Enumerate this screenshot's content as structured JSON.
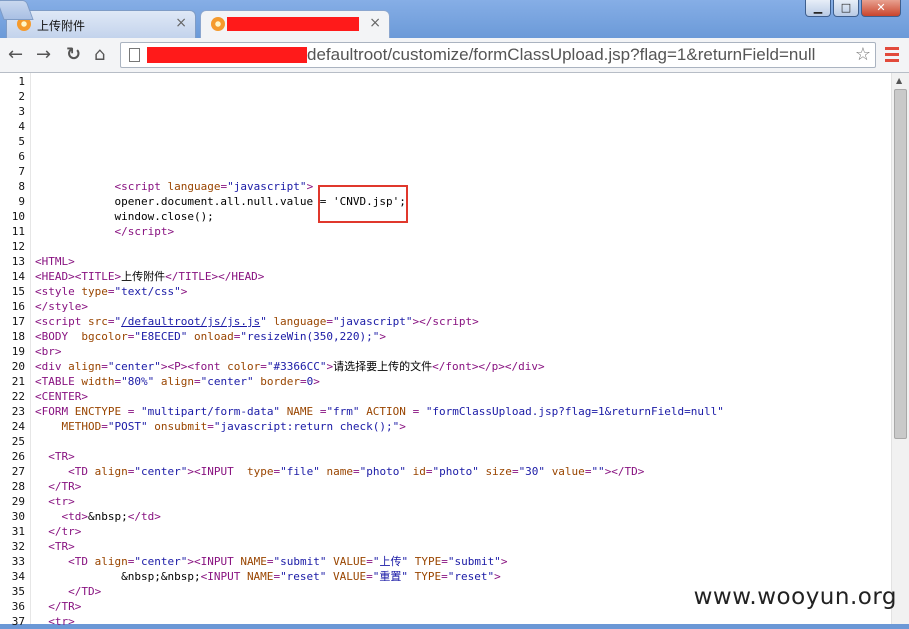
{
  "tabs": [
    {
      "title": "上传附件",
      "active": false
    },
    {
      "title": "",
      "active": true,
      "redacted": true
    }
  ],
  "window_controls": {
    "minimize": "▁",
    "maximize": "□",
    "close": "✕"
  },
  "toolbar": {
    "back": "←",
    "forward": "→",
    "reload": "↻",
    "home": "⌂",
    "url_visible": "defaultroot/customize/formClassUpload.jsp?flag=1&returnField=null",
    "bookmark": "☆"
  },
  "source_lines": [
    {
      "n": "1",
      "html": ""
    },
    {
      "n": "2",
      "html": ""
    },
    {
      "n": "3",
      "html": ""
    },
    {
      "n": "4",
      "html": ""
    },
    {
      "n": "5",
      "html": ""
    },
    {
      "n": "6",
      "html": ""
    },
    {
      "n": "7",
      "html": ""
    },
    {
      "n": "8",
      "html": "            <span class='tag'>&lt;script </span><span class='attr'>language</span><span class='tag'>=</span><span class='val'>\"javascript\"</span><span class='tag'>&gt;</span>"
    },
    {
      "n": "9",
      "html": "            opener.document.all.null.value = 'CNVD.jsp';"
    },
    {
      "n": "10",
      "html": "            window.close();"
    },
    {
      "n": "11",
      "html": "            <span class='tag'>&lt;/script&gt;</span>"
    },
    {
      "n": "12",
      "html": ""
    },
    {
      "n": "13",
      "html": "<span class='tag'>&lt;HTML&gt;</span>"
    },
    {
      "n": "14",
      "html": "<span class='tag'>&lt;HEAD&gt;&lt;TITLE&gt;</span>上传附件<span class='tag'>&lt;/TITLE&gt;&lt;/HEAD&gt;</span>"
    },
    {
      "n": "15",
      "html": "<span class='tag'>&lt;style </span><span class='attr'>type</span><span class='tag'>=</span><span class='val'>\"text/css\"</span><span class='tag'>&gt;</span>"
    },
    {
      "n": "16",
      "html": "<span class='tag'>&lt;/style&gt;</span>"
    },
    {
      "n": "17",
      "html": "<span class='tag'>&lt;script </span><span class='attr'>src</span><span class='tag'>=</span><span class='val'>\"<span class='lnk'>/defaultroot/js/js.js</span>\"</span> <span class='attr'>language</span><span class='tag'>=</span><span class='val'>\"javascript\"</span><span class='tag'>&gt;&lt;/script&gt;</span>"
    },
    {
      "n": "18",
      "html": "<span class='tag'>&lt;BODY  </span><span class='attr'>bgcolor</span><span class='tag'>=</span><span class='val'>\"E8ECED\"</span> <span class='attr'>onload</span><span class='tag'>=</span><span class='val'>\"resizeWin(350,220);\"</span><span class='tag'>&gt;</span>"
    },
    {
      "n": "19",
      "html": "<span class='tag'>&lt;br&gt;</span>"
    },
    {
      "n": "20",
      "html": "<span class='tag'>&lt;div </span><span class='attr'>align</span><span class='tag'>=</span><span class='val'>\"center\"</span><span class='tag'>&gt;&lt;P&gt;&lt;font </span><span class='attr'>color</span><span class='tag'>=</span><span class='val'>\"#3366CC\"</span><span class='tag'>&gt;</span>请选择要上传的文件<span class='tag'>&lt;/font&gt;&lt;/p&gt;&lt;/div&gt;</span>"
    },
    {
      "n": "21",
      "html": "<span class='tag'>&lt;TABLE </span><span class='attr'>width</span><span class='tag'>=</span><span class='val'>\"80%\"</span> <span class='attr'>align</span><span class='tag'>=</span><span class='val'>\"center\"</span> <span class='attr'>border</span><span class='tag'>=</span><span class='val'>0</span><span class='tag'>&gt;</span>"
    },
    {
      "n": "22",
      "html": "<span class='tag'>&lt;CENTER&gt;</span>"
    },
    {
      "n": "23",
      "html": "<span class='tag'>&lt;FORM </span><span class='attr'>ENCTYPE</span> <span class='tag'>=</span> <span class='val'>\"multipart/form-data\"</span> <span class='attr'>NAME</span> <span class='tag'>=</span><span class='val'>\"frm\"</span> <span class='attr'>ACTION</span> <span class='tag'>=</span> <span class='val'>\"formClassUpload.jsp?flag=1&amp;returnField=null\"</span>"
    },
    {
      "n": "24",
      "html": "    <span class='attr'>METHOD</span><span class='tag'>=</span><span class='val'>\"POST\"</span> <span class='attr'>onsubmit</span><span class='tag'>=</span><span class='val'>\"javascript:return check();\"</span><span class='tag'>&gt;</span>"
    },
    {
      "n": "25",
      "html": ""
    },
    {
      "n": "26",
      "html": "  <span class='tag'>&lt;TR&gt;</span>"
    },
    {
      "n": "27",
      "html": "     <span class='tag'>&lt;TD </span><span class='attr'>align</span><span class='tag'>=</span><span class='val'>\"center\"</span><span class='tag'>&gt;&lt;INPUT  </span><span class='attr'>type</span><span class='tag'>=</span><span class='val'>\"file\"</span> <span class='attr'>name</span><span class='tag'>=</span><span class='val'>\"photo\"</span> <span class='attr'>id</span><span class='tag'>=</span><span class='val'>\"photo\"</span> <span class='attr'>size</span><span class='tag'>=</span><span class='val'>\"30\"</span> <span class='attr'>value</span><span class='tag'>=</span><span class='val'>\"\"</span><span class='tag'>&gt;&lt;/TD&gt;</span>"
    },
    {
      "n": "28",
      "html": "  <span class='tag'>&lt;/TR&gt;</span>"
    },
    {
      "n": "29",
      "html": "  <span class='tag'>&lt;tr&gt;</span>"
    },
    {
      "n": "30",
      "html": "    <span class='tag'>&lt;td&gt;</span>&amp;nbsp;<span class='tag'>&lt;/td&gt;</span>"
    },
    {
      "n": "31",
      "html": "  <span class='tag'>&lt;/tr&gt;</span>"
    },
    {
      "n": "32",
      "html": "  <span class='tag'>&lt;TR&gt;</span>"
    },
    {
      "n": "33",
      "html": "     <span class='tag'>&lt;TD </span><span class='attr'>align</span><span class='tag'>=</span><span class='val'>\"center\"</span><span class='tag'>&gt;&lt;INPUT </span><span class='attr'>NAME</span><span class='tag'>=</span><span class='val'>\"submit\"</span> <span class='attr'>VALUE</span><span class='tag'>=</span><span class='val'>\"上传\"</span> <span class='attr'>TYPE</span><span class='tag'>=</span><span class='val'>\"submit\"</span><span class='tag'>&gt;</span>"
    },
    {
      "n": "34",
      "html": "             &amp;nbsp;&amp;nbsp;<span class='tag'>&lt;INPUT </span><span class='attr'>NAME</span><span class='tag'>=</span><span class='val'>\"reset\"</span> <span class='attr'>VALUE</span><span class='tag'>=</span><span class='val'>\"重置\"</span> <span class='attr'>TYPE</span><span class='tag'>=</span><span class='val'>\"reset\"</span><span class='tag'>&gt;</span>"
    },
    {
      "n": "35",
      "html": "     <span class='tag'>&lt;/TD&gt;</span>"
    },
    {
      "n": "36",
      "html": "  <span class='tag'>&lt;/TR&gt;</span>"
    },
    {
      "n": "37",
      "html": "  <span class='tag'>&lt;tr&gt;</span>"
    }
  ],
  "watermark": "www.wooyun.org"
}
